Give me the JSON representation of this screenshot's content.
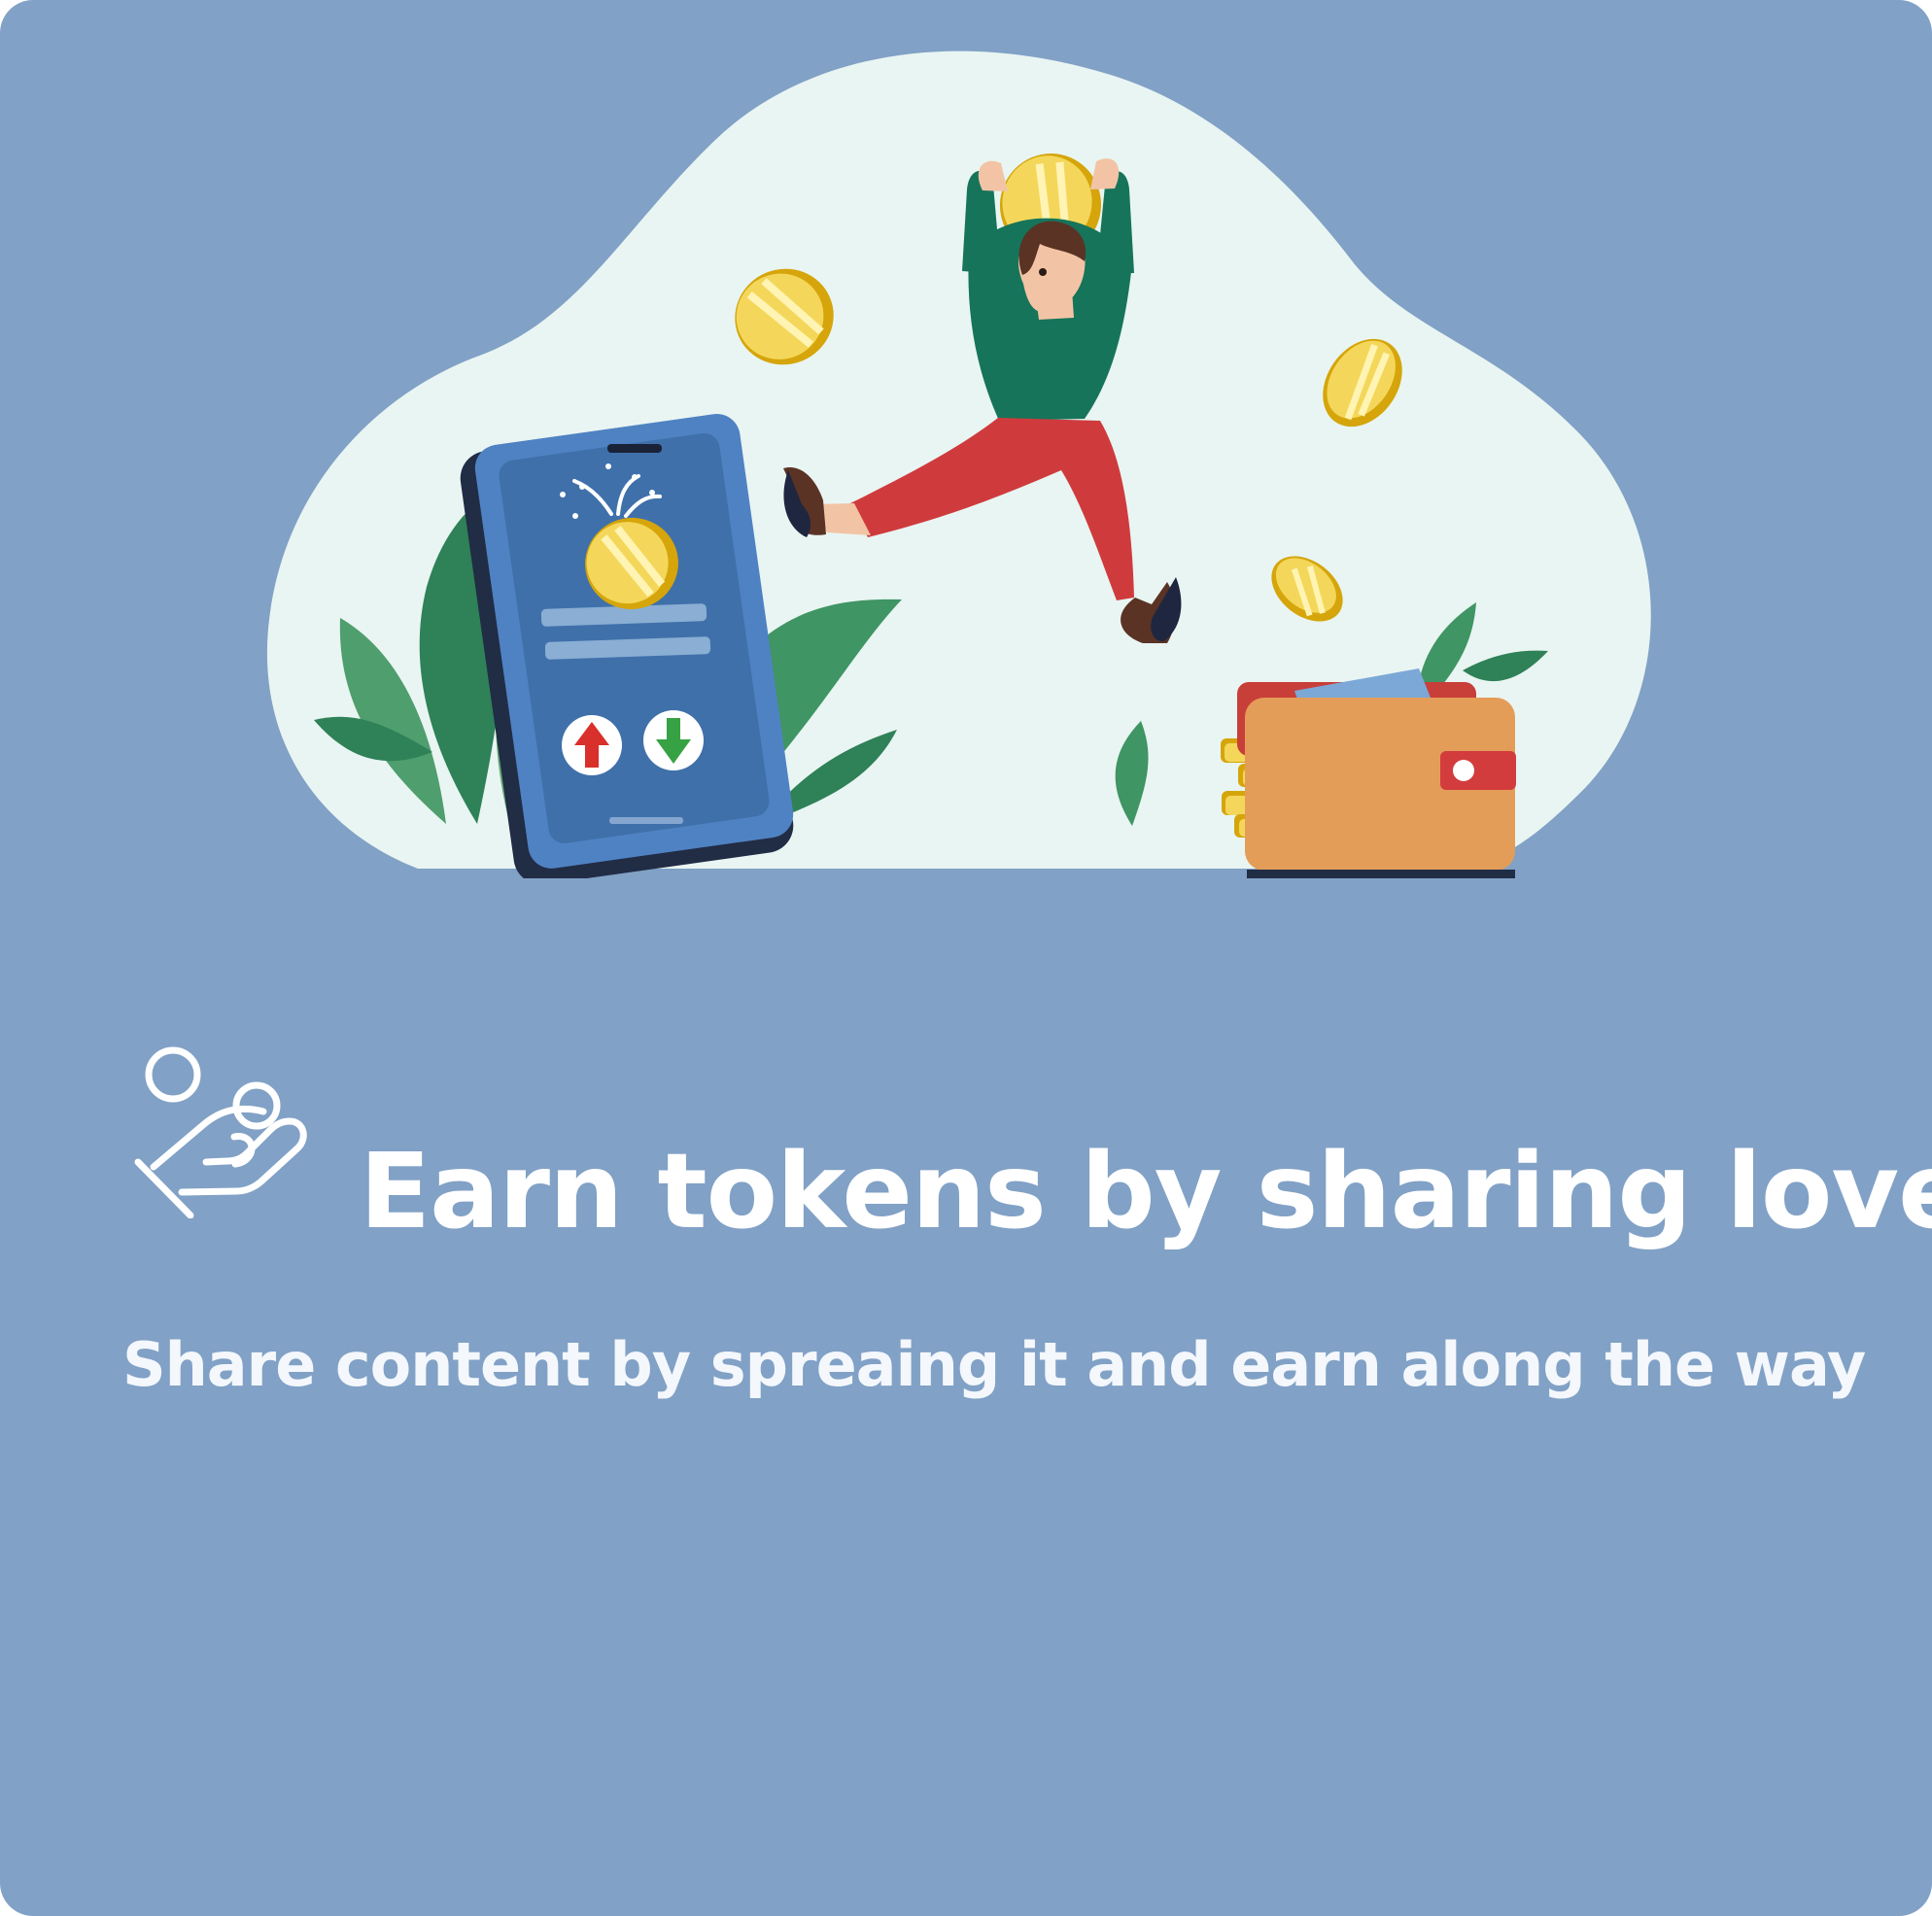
{
  "feature": {
    "title": "Earn tokens by sharing love",
    "description": "Share content by spreaing it and earn along the way",
    "icon": "hand-holding-coins-icon"
  },
  "colors": {
    "background": "#81a1c6",
    "text": "#ffffff",
    "illustration_cloud": "#e9f5f2"
  }
}
